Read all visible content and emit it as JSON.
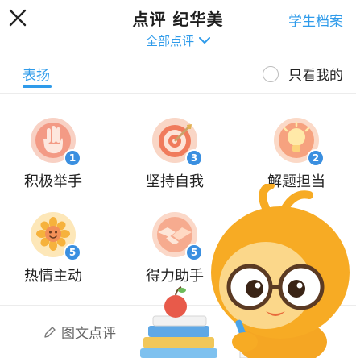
{
  "header": {
    "title": "点评 纪华美",
    "subtitle": "全部点评",
    "archive_link": "学生档案"
  },
  "tabs": {
    "praise_label": "表扬",
    "only_mine_label": "只看我的"
  },
  "categories": [
    {
      "label": "积极举手",
      "count": "1",
      "icon": "raised-hand-icon"
    },
    {
      "label": "坚持自我",
      "count": "3",
      "icon": "target-icon"
    },
    {
      "label": "解题担当",
      "count": "2",
      "icon": "lightbulb-icon"
    },
    {
      "label": "热情主动",
      "count": "5",
      "icon": "sunflower-icon"
    },
    {
      "label": "得力助手",
      "count": "5",
      "icon": "handshake-icon"
    }
  ],
  "bottom": {
    "compose_label": "图文点评"
  },
  "colors": {
    "accent": "#2f9bea",
    "badge": "#3a8fe0"
  }
}
